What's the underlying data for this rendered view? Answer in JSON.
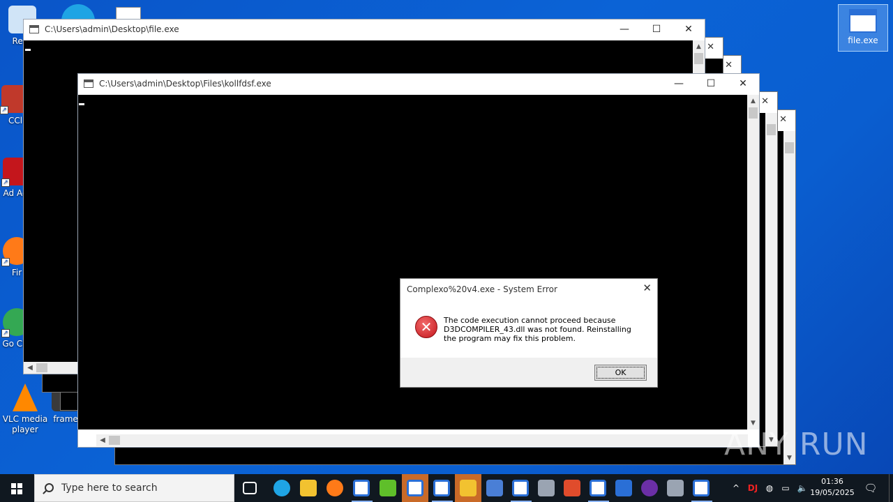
{
  "desktop": {
    "icons": [
      {
        "label": "Recy",
        "color": "#d0e4f7"
      },
      {
        "label": "CCl",
        "color": "#c0392b"
      },
      {
        "label": "Ad Acr",
        "color": "#c4161c"
      },
      {
        "label": "Fir",
        "color": "#ff7a18"
      },
      {
        "label": "Go Chr",
        "color": "#34a853"
      },
      {
        "label": "VLC media player",
        "color": "#ff8800"
      },
      {
        "label": "frame",
        "color": "#3a3a3a"
      }
    ],
    "selected_icon": {
      "label": "file.exe"
    }
  },
  "windows": {
    "main": {
      "title": "C:\\Users\\admin\\Desktop\\file.exe",
      "minimize": "—",
      "maximize": "☐",
      "close": "✕"
    },
    "front": {
      "title": "C:\\Users\\admin\\Desktop\\Files\\kollfdsf.exe",
      "minimize": "—",
      "maximize": "☐",
      "close": "✕"
    },
    "stack_close": "✕"
  },
  "dialog": {
    "title": "Complexo%20v4.exe - System Error",
    "close": "✕",
    "icon": "error-icon",
    "message": "The code execution cannot proceed because D3DCOMPILER_43.dll was not found. Reinstalling the program may fix this problem.",
    "ok_label": "OK"
  },
  "taskbar": {
    "search_placeholder": "Type here to search",
    "time": "01:36",
    "date": "19/05/2025",
    "apps": [
      {
        "name": "task-view-icon",
        "color": "#ffffff"
      },
      {
        "name": "edge-icon",
        "color": "#1fa4e4"
      },
      {
        "name": "explorer-icon",
        "color": "#f2c230"
      },
      {
        "name": "firefox-icon",
        "color": "#ff7a18"
      },
      {
        "name": "console-icon",
        "color": "#ffffff"
      },
      {
        "name": "bh-icon",
        "color": "#5fbf2a"
      },
      {
        "name": "console-icon",
        "color": "#ffffff"
      },
      {
        "name": "console-icon",
        "color": "#ffffff"
      },
      {
        "name": "app-icon",
        "color": "#f2c230"
      },
      {
        "name": "network-tool-icon",
        "color": "#4a7fd6"
      },
      {
        "name": "console-icon",
        "color": "#ffffff"
      },
      {
        "name": "link-icon",
        "color": "#9aa4b2"
      },
      {
        "name": "package-icon",
        "color": "#e04c2c"
      },
      {
        "name": "console-icon",
        "color": "#ffffff"
      },
      {
        "name": "monitor-icon",
        "color": "#2a6fd6"
      },
      {
        "name": "purple-app-icon",
        "color": "#6b2fa6"
      },
      {
        "name": "installer-icon",
        "color": "#9aa4b2"
      },
      {
        "name": "console-icon",
        "color": "#ffffff"
      }
    ],
    "tray_chevron": "^",
    "notification": "🗨"
  },
  "watermark": "ANY RUN"
}
